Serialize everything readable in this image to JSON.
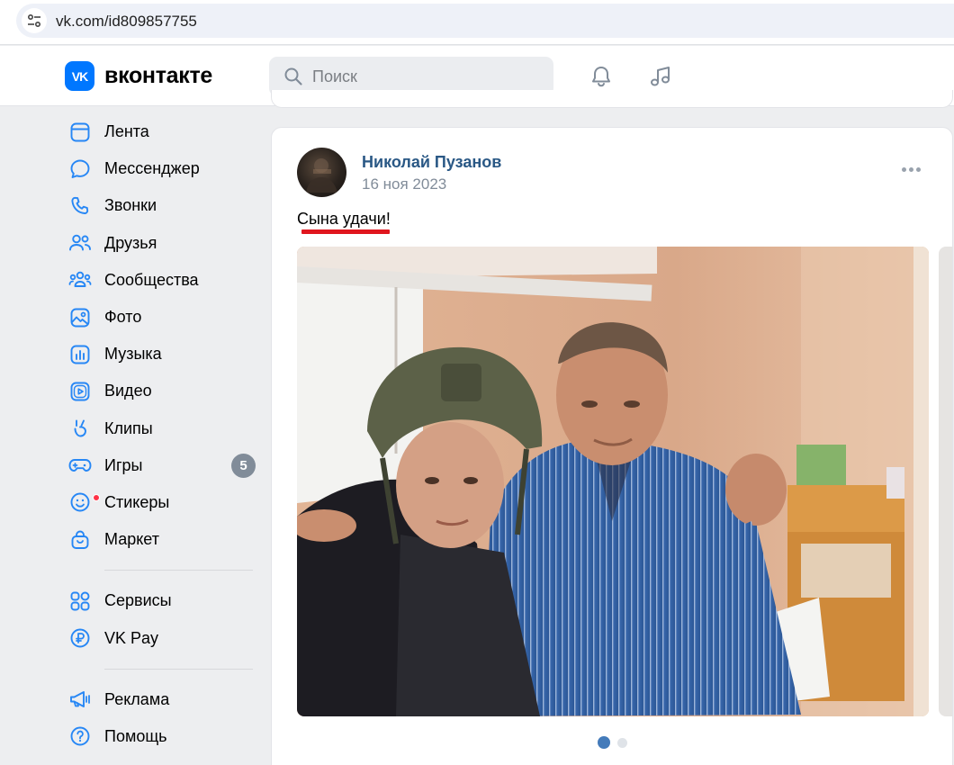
{
  "browser": {
    "url": "vk.com/id809857755"
  },
  "header": {
    "logo_text": "VK",
    "wordmark": "вконтакте",
    "search_placeholder": "Поиск",
    "brand_color": "#0077ff"
  },
  "sidebar": {
    "items": [
      {
        "label": "Лента",
        "icon": "newsfeed-icon"
      },
      {
        "label": "Мессенджер",
        "icon": "messenger-icon"
      },
      {
        "label": "Звонки",
        "icon": "phone-icon"
      },
      {
        "label": "Друзья",
        "icon": "friends-icon"
      },
      {
        "label": "Сообщества",
        "icon": "communities-icon"
      },
      {
        "label": "Фото",
        "icon": "photo-icon"
      },
      {
        "label": "Музыка",
        "icon": "music-icon"
      },
      {
        "label": "Видео",
        "icon": "video-icon"
      },
      {
        "label": "Клипы",
        "icon": "clips-icon"
      },
      {
        "label": "Игры",
        "icon": "games-icon",
        "badge": "5"
      },
      {
        "label": "Стикеры",
        "icon": "stickers-icon"
      },
      {
        "label": "Маркет",
        "icon": "market-icon"
      }
    ],
    "secondary": [
      {
        "label": "Сервисы",
        "icon": "services-icon"
      },
      {
        "label": "VK Pay",
        "icon": "vkpay-icon"
      }
    ],
    "tertiary": [
      {
        "label": "Реклама",
        "icon": "ads-icon"
      },
      {
        "label": "Помощь",
        "icon": "help-icon"
      }
    ]
  },
  "post": {
    "author": "Николай Пузанов",
    "date": "16 ноя 2023",
    "text": "Сына удачи!",
    "author_color": "#2a5885",
    "highlight_color": "#e0161e",
    "carousel": {
      "total": 2,
      "active": 1
    }
  }
}
